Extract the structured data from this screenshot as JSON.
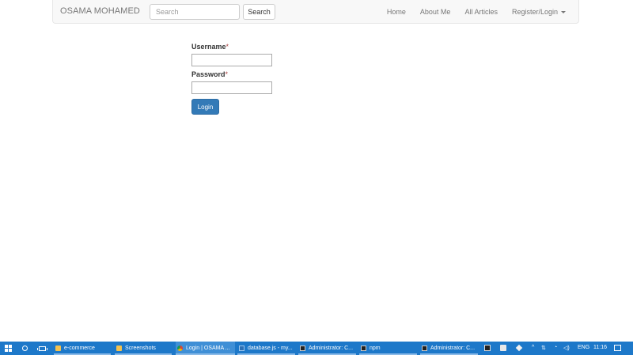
{
  "navbar": {
    "brand": "OSAMA MOHAMED",
    "search_placeholder": "Search",
    "search_button": "Search",
    "links": [
      "Home",
      "About Me",
      "All Articles"
    ],
    "dropdown": "Register/Login"
  },
  "form": {
    "username_label": "Username",
    "password_label": "Password",
    "required_mark": "*",
    "login_button": "Login"
  },
  "taskbar": {
    "apps": [
      {
        "label": "e-commerce",
        "icon": "folder-icon",
        "active": false
      },
      {
        "label": "Screenshots",
        "icon": "folder-icon",
        "active": false
      },
      {
        "label": "Login | OSAMA ...",
        "icon": "chrome-icon",
        "active": true
      },
      {
        "label": "database.js - my...",
        "icon": "vscode-icon",
        "active": false
      },
      {
        "label": "Administrator: C...",
        "icon": "cmd-icon",
        "active": false
      },
      {
        "label": "npm",
        "icon": "cmd-icon",
        "active": false
      },
      {
        "label": "Administrator: C...",
        "icon": "cmd-icon",
        "active": false
      }
    ],
    "tray": {
      "language": "ENG",
      "time": "11:16"
    }
  },
  "colors": {
    "primary_button": "#337ab7",
    "taskbar": "#1d78c9",
    "navbar_bg": "#f8f8f8"
  }
}
